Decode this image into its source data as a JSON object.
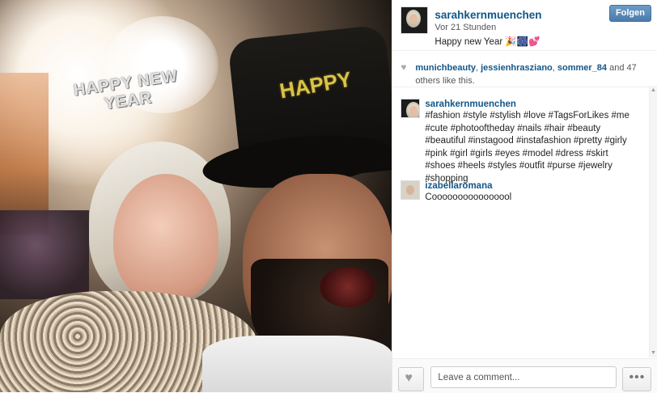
{
  "post": {
    "photo_alt_text": "",
    "tiara_text": "HAPPY NEW YEAR",
    "hat_text": "HAPPY"
  },
  "header": {
    "username": "sarahkernmuenchen",
    "time": "Vor 21 Stunden",
    "caption": "Happy new Year 🎉🎆💕",
    "follow_label": "Folgen"
  },
  "likes": {
    "users": [
      "munichbeauty",
      "jessienhrasziano",
      "sommer_84"
    ],
    "sep1": ", ",
    "sep2": ", ",
    "and_text": " and ",
    "count": "47",
    "suffix": " others like this."
  },
  "comments": [
    {
      "username": "sarahkernmuenchen",
      "text": "#fashion #style #stylish #love #TagsForLikes #me #cute #photooftheday #nails #hair #beauty #beautiful #instagood #instafashion #pretty #girly #pink #girl #girls #eyes #model #dress #skirt #shoes #heels #styles #outfit #purse #jewelry #shopping"
    },
    {
      "username": "izabellaromana",
      "text": "Coooooooooooooool"
    }
  ],
  "footer": {
    "comment_placeholder": "Leave a comment...",
    "more_label": "•••"
  },
  "icons": {
    "heart": "heart-icon",
    "ellipsis": "ellipsis-icon"
  },
  "colors": {
    "link": "#125688",
    "follow_button": "#4a7bab"
  }
}
